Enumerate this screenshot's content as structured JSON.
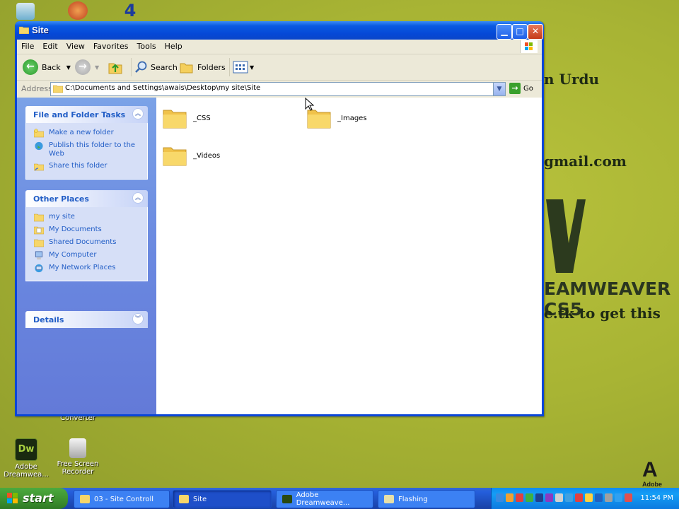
{
  "desktop": {
    "icons": [
      {
        "label": "Adobe Dreamwea..."
      },
      {
        "label": "Free Screen Recorder"
      },
      {
        "label": "Converter"
      }
    ],
    "wallpaper_lines": [
      "n Urdu",
      "gmail.com",
      "EAMWEAVER CS5",
      "e.tk to get this"
    ],
    "adobe_logo": "Adobe"
  },
  "window": {
    "title": "Site",
    "menu": [
      "File",
      "Edit",
      "View",
      "Favorites",
      "Tools",
      "Help"
    ],
    "toolbar": {
      "back": "Back",
      "search": "Search",
      "folders": "Folders"
    },
    "address": {
      "label": "Address",
      "path": "C:\\Documents and Settings\\awais\\Desktop\\my site\\Site",
      "go": "Go"
    },
    "panels": [
      {
        "title": "File and Folder Tasks",
        "items": [
          "Make a new folder",
          "Publish this folder to the Web",
          "Share this folder"
        ]
      },
      {
        "title": "Other Places",
        "items": [
          "my site",
          "My Documents",
          "Shared Documents",
          "My Computer",
          "My Network Places"
        ]
      },
      {
        "title": "Details",
        "items": []
      }
    ],
    "folders": [
      "_CSS",
      "_Images",
      "_Videos"
    ]
  },
  "taskbar": {
    "start": "start",
    "tasks": [
      "03 - Site Controll",
      "Site",
      "Adobe Dreamweave...",
      "Flashing"
    ],
    "clock": "11:54 PM"
  },
  "colors": {
    "xp_blue": "#0a46d8",
    "task_pane": "#6a88e0",
    "link": "#215dc6",
    "start_green": "#3c8f2e"
  }
}
